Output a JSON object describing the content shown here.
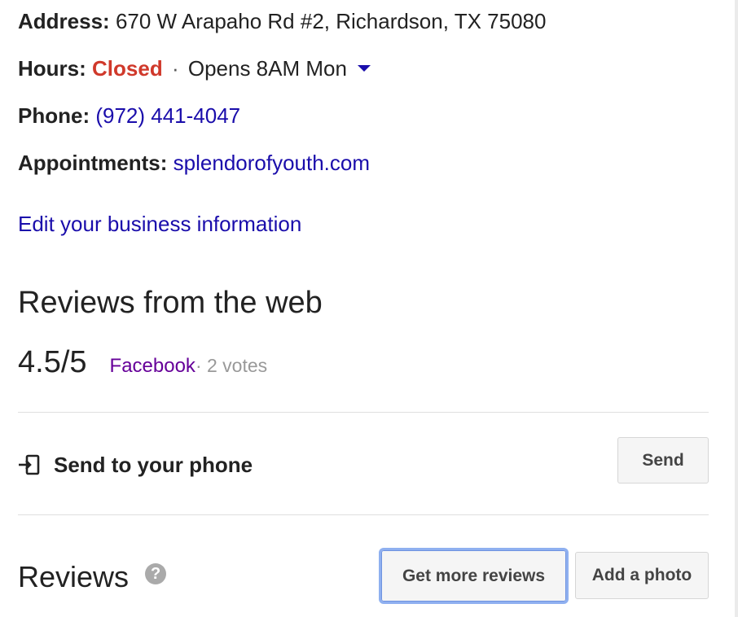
{
  "business_info": {
    "address": {
      "label": "Address:",
      "value": "670 W Arapaho Rd #2, Richardson, TX 75080"
    },
    "hours": {
      "label": "Hours:",
      "status": "Closed",
      "separator": "·",
      "opens": "Opens 8AM Mon"
    },
    "phone": {
      "label": "Phone:",
      "value": "(972) 441-4047"
    },
    "appointments": {
      "label": "Appointments:",
      "value": "splendorofyouth.com"
    },
    "edit_link": "Edit your business information"
  },
  "web_reviews": {
    "heading": "Reviews from the web",
    "score": "4.5/5",
    "source": "Facebook",
    "votes": " · 2 votes"
  },
  "send_to_phone": {
    "label": "Send to your phone",
    "button": "Send",
    "icon": "send-to-device-icon"
  },
  "reviews": {
    "heading": "Reviews",
    "help_glyph": "?",
    "get_more_button": "Get more reviews",
    "add_photo_button": "Add a photo"
  },
  "colors": {
    "link": "#1a0dab",
    "closed": "#d0392b",
    "visited_link": "#660099",
    "focus_ring": "#8fb0f0"
  }
}
